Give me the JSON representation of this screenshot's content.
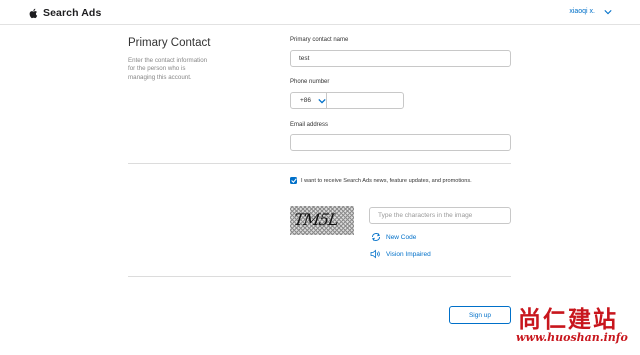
{
  "header": {
    "app_name": "Search Ads",
    "user_name": "xiaoqi x."
  },
  "primary_contact": {
    "title": "Primary Contact",
    "description": "Enter the contact information for the person who is managing this account.",
    "name_label": "Primary contact name",
    "name_value": "test",
    "phone_label": "Phone number",
    "country_code": "+86",
    "phone_value": "",
    "email_label": "Email address",
    "email_value": ""
  },
  "consent": {
    "checked": true,
    "label": "I want to receive Search Ads news, feature updates, and promotions."
  },
  "captcha": {
    "image_text": "TM5L",
    "input_placeholder": "Type the characters in the image",
    "new_code_label": "New Code",
    "vision_impaired_label": "Vision Impaired"
  },
  "actions": {
    "signup_label": "Sign up"
  },
  "watermark": {
    "title": "尚仁建站",
    "url": "www.huoshan.info"
  },
  "colors": {
    "accent": "#0070c9",
    "watermark": "#c8161d",
    "divider": "#dcdcdc"
  },
  "icons": {
    "brand": "apple-logo-icon",
    "user_menu": "chevron-down-icon",
    "country_code": "chevron-down-icon",
    "checkbox": "checkmark-icon",
    "new_code": "refresh-icon",
    "vision_impaired": "speaker-icon"
  }
}
